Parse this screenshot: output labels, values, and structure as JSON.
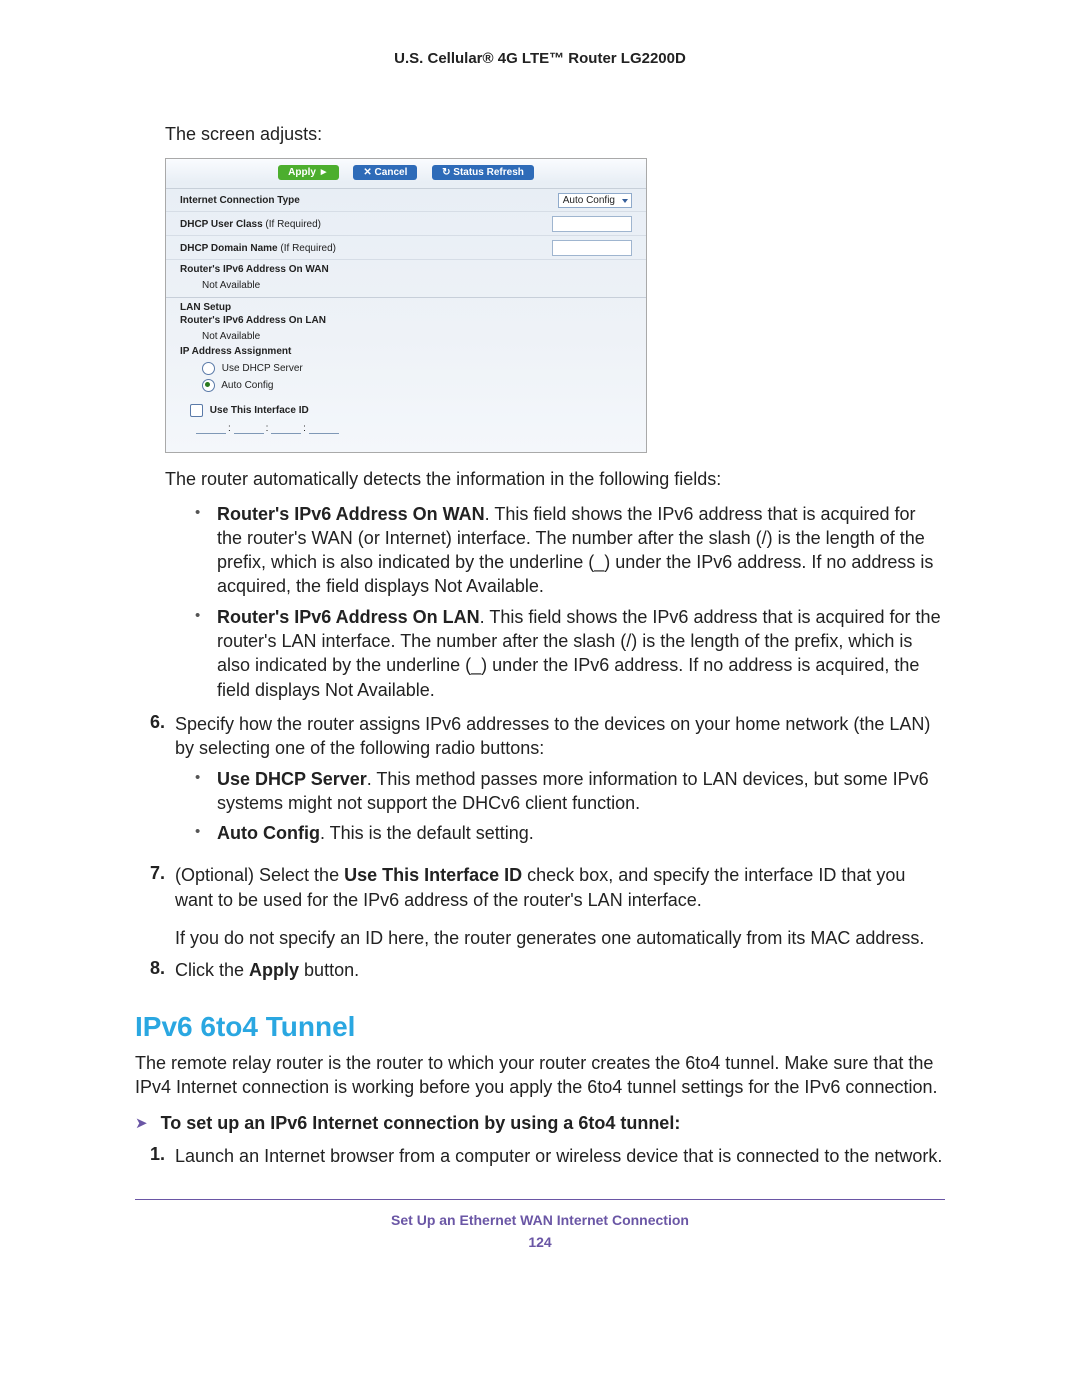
{
  "header": "U.S. Cellular® 4G LTE™ Router LG2200D",
  "intro": "The screen adjusts:",
  "panel": {
    "buttons": {
      "apply": "Apply ►",
      "cancel": "✕ Cancel",
      "refresh": "↻ Status Refresh"
    },
    "connTypeLabel": "Internet Connection Type",
    "connTypeValue": "Auto Config",
    "dhcpUserClass": "DHCP User Class",
    "dhcpDomainName": "DHCP Domain Name",
    "ifRequired": "(If Required)",
    "wanAddrLabel": "Router's IPv6 Address On WAN",
    "notAvailable": "Not Available",
    "lanSetup": "LAN Setup",
    "lanAddrLabel": "Router's IPv6 Address On LAN",
    "ipAssign": "IP Address Assignment",
    "useDhcp": "Use DHCP Server",
    "autoConfig": "Auto Config",
    "useInterfaceId": "Use This Interface ID"
  },
  "afterImg": "The router automatically detects the information in the following fields:",
  "bullets": {
    "wan_b": "Router's IPv6 Address On WAN",
    "wan_t": ". This field shows the IPv6 address that is acquired for the router's WAN (or Internet) interface. The number after the slash (/) is the length of the prefix, which is also indicated by the underline (_) under the IPv6 address. If no address is acquired, the field displays Not Available.",
    "lan_b": "Router's IPv6 Address On LAN",
    "lan_t": ". This field shows the IPv6 address that is acquired for the router's LAN interface. The number after the slash (/) is the length of the prefix, which is also indicated by the underline (_) under the IPv6 address. If no address is acquired, the field displays Not Available."
  },
  "step6": {
    "num": "6.",
    "text": "Specify how the router assigns IPv6 addresses to the devices on your home network (the LAN) by selecting one of the following radio buttons:",
    "dhcp_b": "Use DHCP Server",
    "dhcp_t": ". This method passes more information to LAN devices, but some IPv6 systems might not support the DHCv6 client function.",
    "auto_b": "Auto Config",
    "auto_t": ". This is the default setting."
  },
  "step7": {
    "num": "7.",
    "pre": "(Optional) Select the ",
    "bold": "Use This Interface ID",
    "post": " check box, and specify the interface ID that you want to be used for the IPv6 address of the router's LAN interface.",
    "para": "If you do not specify an ID here, the router generates one automatically from its MAC address."
  },
  "step8": {
    "num": "8.",
    "pre": "Click the ",
    "bold": "Apply",
    "post": " button."
  },
  "section": {
    "title": "IPv6 6to4 Tunnel",
    "body": "The remote relay router is the router to which your router creates the 6to4 tunnel. Make sure that the IPv4 Internet connection is working before you apply the 6to4 tunnel settings for the IPv6 connection.",
    "procLead": "To set up an IPv6 Internet connection by using a 6to4 tunnel:",
    "s1num": "1.",
    "s1text": "Launch an Internet browser from a computer or wireless device that is connected to the network."
  },
  "footer": {
    "title": "Set Up an Ethernet WAN Internet Connection",
    "page": "124"
  }
}
